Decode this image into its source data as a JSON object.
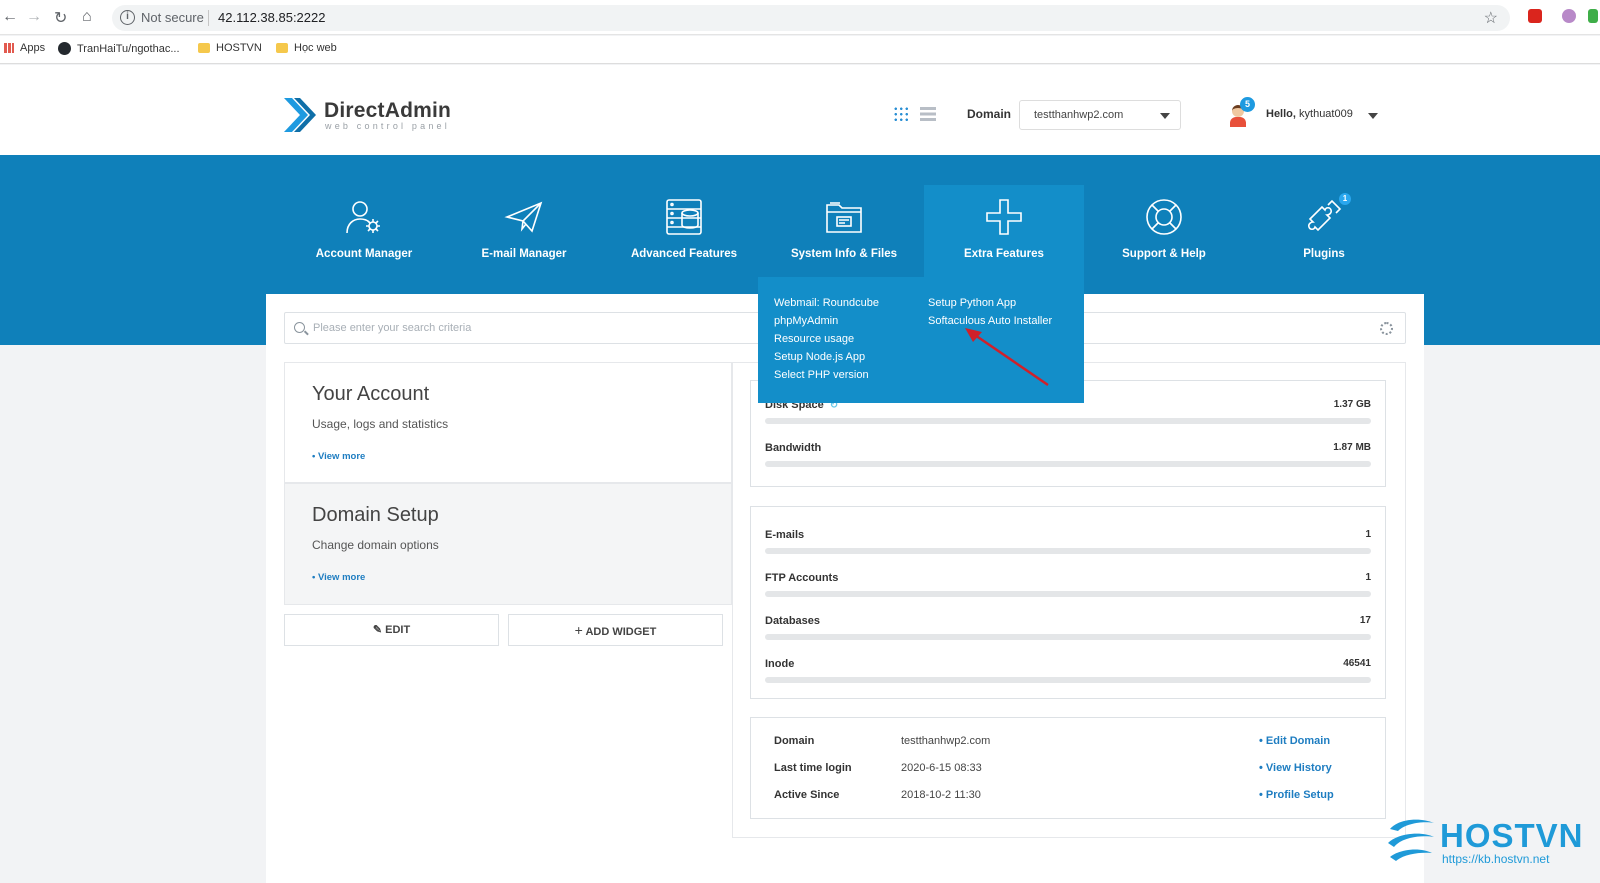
{
  "browser": {
    "security": "Not secure",
    "url": "42.112.38.85:2222",
    "bookmarks": [
      "Apps",
      "TranHaiTu/ngothac...",
      "HOSTVN",
      "Học web"
    ]
  },
  "header": {
    "logo_title": "DirectAdmin",
    "logo_subtitle": "web control panel",
    "domain_label": "Domain",
    "domain_value": "testthanhwp2.com",
    "notification_count": "5",
    "hello_prefix": "Hello,",
    "username": "kythuat009"
  },
  "nav": {
    "items": [
      {
        "label": "Account Manager",
        "icon": "account-manager-icon"
      },
      {
        "label": "E-mail Manager",
        "icon": "paper-plane-icon"
      },
      {
        "label": "Advanced Features",
        "icon": "server-stack-icon"
      },
      {
        "label": "System Info & Files",
        "icon": "folder-icon"
      },
      {
        "label": "Extra Features",
        "icon": "plus-icon"
      },
      {
        "label": "Support & Help",
        "icon": "lifebuoy-icon"
      },
      {
        "label": "Plugins",
        "icon": "puzzle-icon"
      }
    ],
    "plugins_badge": "1"
  },
  "extra_menu": {
    "col1": [
      "Webmail: Roundcube",
      "phpMyAdmin",
      "Resource usage",
      "Setup Node.js App",
      "Select PHP version"
    ],
    "col2": [
      "Setup Python App",
      "Softaculous Auto Installer"
    ]
  },
  "search": {
    "placeholder": "Please enter your search criteria"
  },
  "cards": [
    {
      "title": "Your Account",
      "subtitle": "Usage, logs and statistics",
      "link": "• View more"
    },
    {
      "title": "Domain Setup",
      "subtitle": "Change domain options",
      "link": "• View more"
    }
  ],
  "buttons": {
    "edit": "EDIT",
    "add_widget": "ADD WIDGET"
  },
  "usage": [
    {
      "name": "Disk Space",
      "value": "1.37 GB"
    },
    {
      "name": "Bandwidth",
      "value": "1.87 MB"
    }
  ],
  "counts": [
    {
      "name": "E-mails",
      "value": "1"
    },
    {
      "name": "FTP Accounts",
      "value": "1"
    },
    {
      "name": "Databases",
      "value": "17"
    },
    {
      "name": "Inode",
      "value": "46541"
    }
  ],
  "info": [
    {
      "key": "Domain",
      "value": "testthanhwp2.com",
      "link": "• Edit Domain"
    },
    {
      "key": "Last time login",
      "value": "2020-6-15 08:33",
      "link": "• View History"
    },
    {
      "key": "Active Since",
      "value": "2018-10-2 11:30",
      "link": "• Profile Setup"
    }
  ],
  "watermark": {
    "brand": "HOSTVN",
    "url": "https://kb.hostvn.net"
  },
  "colors": {
    "band": "#0f80ba",
    "active_nav": "#138ec9",
    "link": "#1e7dc1",
    "annotation_arrow": "#d0202a"
  }
}
